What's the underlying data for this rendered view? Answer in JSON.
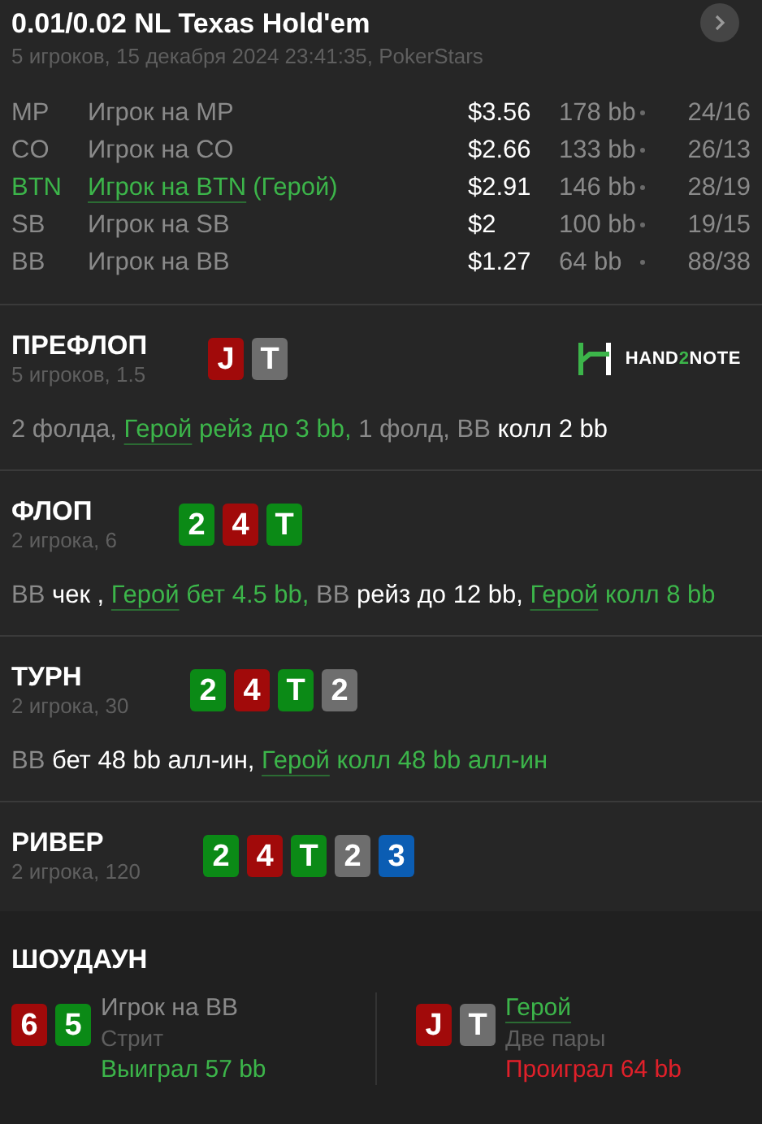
{
  "header": {
    "title": "0.01/0.02 NL Texas Hold'em",
    "subtitle": "5 игроков, 15 декабря 2024 23:41:35, PokerStars"
  },
  "players": [
    {
      "position": "MP",
      "name": "Игрок на MP",
      "hero": false,
      "stack": "$3.56",
      "bb": "178 bb",
      "stats": "24/16"
    },
    {
      "position": "CO",
      "name": "Игрок на CO",
      "hero": false,
      "stack": "$2.66",
      "bb": "133 bb",
      "stats": "26/13"
    },
    {
      "position": "BTN",
      "name": "Игрок на BTN",
      "tag": "(Герой)",
      "hero": true,
      "stack": "$2.91",
      "bb": "146 bb",
      "stats": "28/19"
    },
    {
      "position": "SB",
      "name": "Игрок на SB",
      "hero": false,
      "stack": "$2",
      "bb": "100 bb",
      "stats": "19/15"
    },
    {
      "position": "BB",
      "name": "Игрок на BB",
      "hero": false,
      "stack": "$1.27",
      "bb": "64 bb",
      "stats": "88/38"
    }
  ],
  "logo": {
    "before": "HAND",
    "accent": "2",
    "after": "NOTE"
  },
  "streets": [
    {
      "title": "ПРЕФЛОП",
      "subtitle": "5 игроков, 1.5",
      "cards": [
        {
          "rank": "J",
          "color": "#a10a0a"
        },
        {
          "rank": "T",
          "color": "#6e6e6e"
        }
      ],
      "actions": [
        {
          "kind": "muted",
          "text": "2 фолда,"
        },
        {
          "kind": "hero_link",
          "text": "Герой"
        },
        {
          "kind": "hero",
          "text": "рейз до 3 bb,"
        },
        {
          "kind": "muted",
          "text": "1 фолд, BB"
        },
        {
          "kind": "plain",
          "text": "колл 2 bb"
        }
      ]
    },
    {
      "title": "ФЛОП",
      "subtitle": "2 игрока, 6",
      "cards": [
        {
          "rank": "2",
          "color": "#0b8a16"
        },
        {
          "rank": "4",
          "color": "#a10a0a"
        },
        {
          "rank": "T",
          "color": "#0b8a16"
        }
      ],
      "actions": [
        {
          "kind": "muted",
          "text": "BB"
        },
        {
          "kind": "plain",
          "text": "чек ,"
        },
        {
          "kind": "hero_link",
          "text": "Герой"
        },
        {
          "kind": "hero",
          "text": "бет 4.5 bb,"
        },
        {
          "kind": "muted",
          "text": "BB"
        },
        {
          "kind": "plain",
          "text": "рейз до 12 bb,"
        },
        {
          "kind": "hero_link",
          "text": "Герой"
        },
        {
          "kind": "hero",
          "text": "колл 8 bb"
        }
      ]
    },
    {
      "title": "ТУРН",
      "subtitle": "2 игрока, 30",
      "cards": [
        {
          "rank": "2",
          "color": "#0b8a16"
        },
        {
          "rank": "4",
          "color": "#a10a0a"
        },
        {
          "rank": "T",
          "color": "#0b8a16"
        },
        {
          "rank": "2",
          "color": "#6e6e6e"
        }
      ],
      "actions": [
        {
          "kind": "muted",
          "text": "BB"
        },
        {
          "kind": "plain",
          "text": "бет 48 bb алл-ин,"
        },
        {
          "kind": "hero_link",
          "text": "Герой"
        },
        {
          "kind": "hero",
          "text": "колл 48 bb алл-ин"
        }
      ]
    },
    {
      "title": "РИВЕР",
      "subtitle": "2 игрока, 120",
      "cards": [
        {
          "rank": "2",
          "color": "#0b8a16"
        },
        {
          "rank": "4",
          "color": "#a10a0a"
        },
        {
          "rank": "T",
          "color": "#0b8a16"
        },
        {
          "rank": "2",
          "color": "#6e6e6e"
        },
        {
          "rank": "3",
          "color": "#0b5db3"
        }
      ]
    }
  ],
  "showdown": {
    "title": "ШОУДАУН",
    "entries": [
      {
        "cards": [
          {
            "rank": "6",
            "color": "#a10a0a"
          },
          {
            "rank": "5",
            "color": "#0b8a16"
          }
        ],
        "name": "Игрок на BB",
        "hero": false,
        "hand": "Стрит",
        "won": true,
        "result": "Выиграл 57 bb"
      },
      {
        "cards": [
          {
            "rank": "J",
            "color": "#a10a0a"
          },
          {
            "rank": "T",
            "color": "#6e6e6e"
          }
        ],
        "name": "Герой",
        "hero": true,
        "hand": "Две пары",
        "won": false,
        "result": "Проиграл 64 bb"
      }
    ]
  }
}
